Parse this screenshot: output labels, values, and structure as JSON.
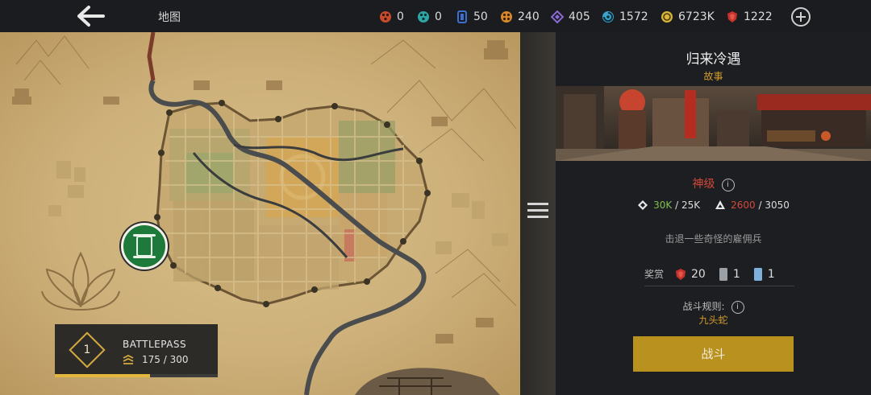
{
  "topbar": {
    "back_icon": "arrow-left-icon",
    "title": "地图",
    "add_icon": "plus-circle-icon",
    "currencies": [
      {
        "name": "red-token-icon",
        "value": "0",
        "color": "#c94a2b"
      },
      {
        "name": "teal-token-icon",
        "value": "0",
        "color": "#2fa6a6"
      },
      {
        "name": "blue-card-icon",
        "value": "50",
        "color": "#3d6fd1"
      },
      {
        "name": "orange-token-icon",
        "value": "240",
        "color": "#d98a2a"
      },
      {
        "name": "purple-crystal-icon",
        "value": "405",
        "color": "#8a6bd6"
      },
      {
        "name": "swirl-token-icon",
        "value": "1572",
        "color": "#3aa3c9"
      },
      {
        "name": "gold-coin-icon",
        "value": "6723K",
        "color": "#d9b43b"
      },
      {
        "name": "red-gem-icon",
        "value": "1222",
        "color": "#c9332b"
      }
    ]
  },
  "map": {
    "menu_icon": "hamburger-menu-icon",
    "marker_icon": "scroll-icon",
    "marker_color": "#1e7a3a"
  },
  "battlepass": {
    "level": "1",
    "title": "BATTLEPASS",
    "progress_text": "175 / 300",
    "progress_fraction": 0.583,
    "accent": "#e3b73e"
  },
  "mission": {
    "title": "归来冷遇",
    "type": "故事",
    "difficulty": "神级",
    "power": {
      "current": "30K",
      "required": "25K",
      "second_current": "2600",
      "second_required": "3050"
    },
    "objective": "击退一些奇怪的雇佣兵",
    "rewards_label": "奖赏",
    "rewards": [
      {
        "icon": "red-gem-icon",
        "amount": "20"
      },
      {
        "icon": "grey-card-icon",
        "amount": "1"
      },
      {
        "icon": "blue-card-icon",
        "amount": "1"
      }
    ],
    "rules_label": "战斗规则:",
    "rules_value": "九头蛇",
    "fight_label": "战斗",
    "colors": {
      "type": "#d19a2a",
      "difficulty": "#d3493a",
      "button": "#b8911f"
    }
  }
}
